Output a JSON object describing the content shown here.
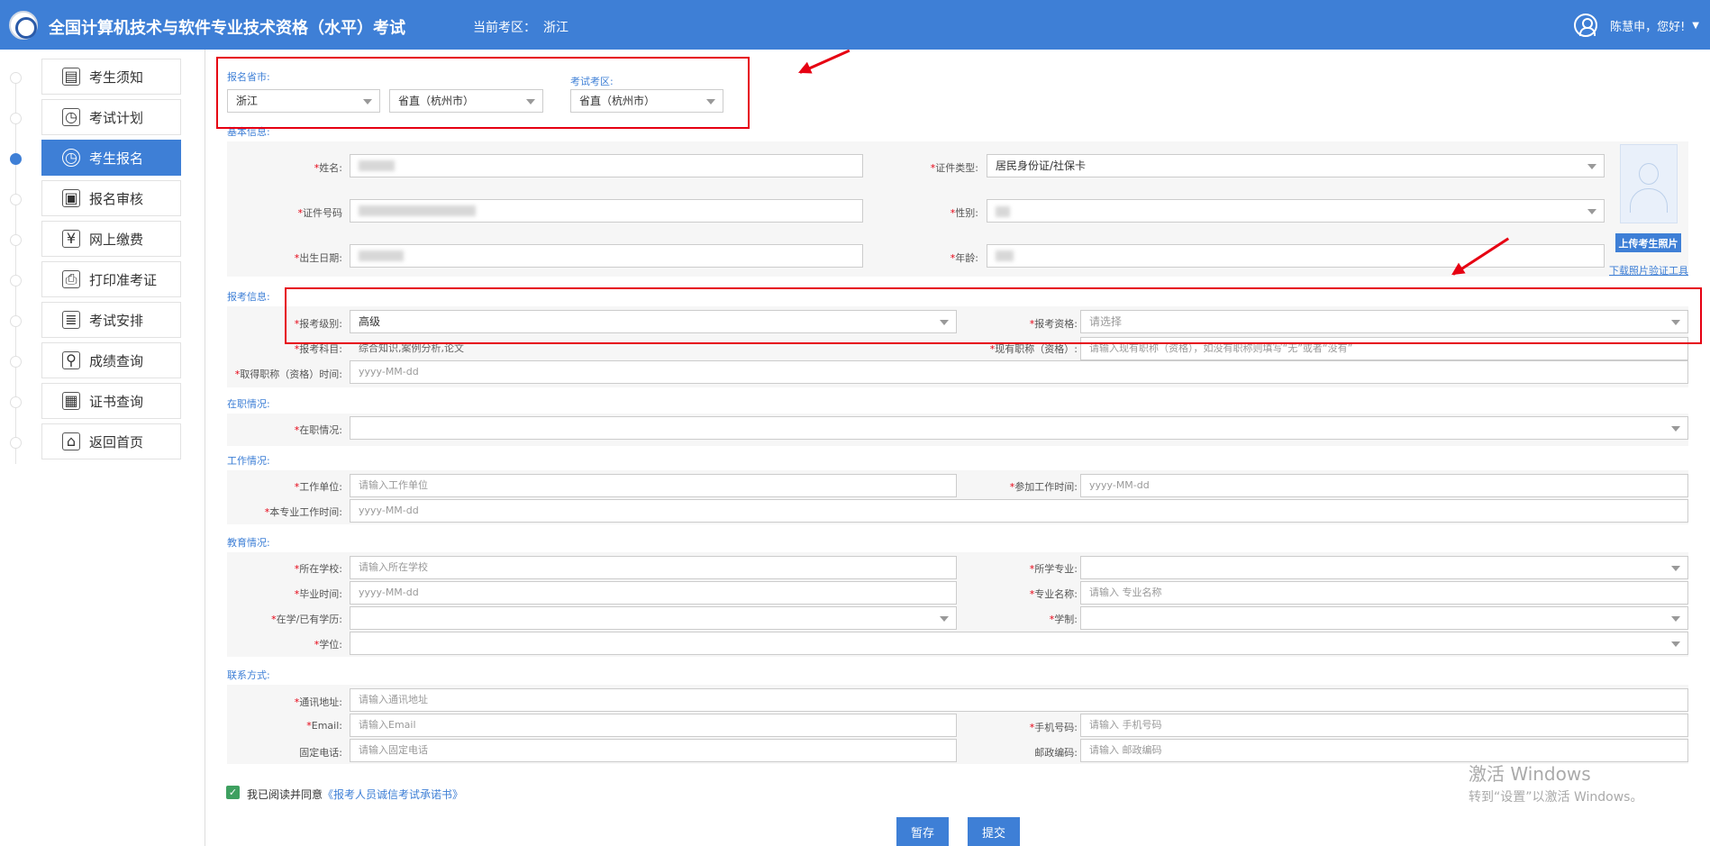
{
  "header": {
    "title": "全国计算机技术与软件专业技术资格（水平）考试",
    "area_label": "当前考区：",
    "area_value": "浙江",
    "greeting": "陈慧申，您好!"
  },
  "sidebar": {
    "items": [
      {
        "label": "考生须知",
        "icon": "▤"
      },
      {
        "label": "考试计划",
        "icon": "◷"
      },
      {
        "label": "考生报名",
        "icon": "◷"
      },
      {
        "label": "报名审核",
        "icon": "▣"
      },
      {
        "label": "网上缴费",
        "icon": "¥"
      },
      {
        "label": "打印准考证",
        "icon": "⎙"
      },
      {
        "label": "考试安排",
        "icon": "≣"
      },
      {
        "label": "成绩查询",
        "icon": "⚲"
      },
      {
        "label": "证书查询",
        "icon": "▦"
      },
      {
        "label": "返回首页",
        "icon": "⌂"
      }
    ]
  },
  "region": {
    "province_label": "报名省市:",
    "exam_area_label": "考试考区:",
    "province_value": "浙江",
    "city_value": "省直（杭州市）",
    "exam_area_value": "省直（杭州市）"
  },
  "basic": {
    "section_label": "基本信息:",
    "name_label": "姓名:",
    "id_type_label": "证件类型:",
    "id_type_value": "居民身份证/社保卡",
    "id_no_label": "证件号码",
    "gender_label": "性别:",
    "birth_label": "出生日期:",
    "age_label": "年龄:",
    "upload_photo": "上传考生照片",
    "download_tool": "下载照片验证工具"
  },
  "apply": {
    "section_label": "报考信息:",
    "level_label": "报考级别:",
    "level_value": "高级",
    "qualification_label": "报考资格:",
    "qualification_placeholder": "请选择",
    "subject_label": "报考科目:",
    "subject_value": "综合知识,案例分析,论文",
    "title_label": "现有职称（资格）:",
    "title_placeholder": "请输入现有职称（资格），如没有职称则填写“无”或者“没有”",
    "title_time_label": "取得职称（资格）时间:",
    "date_placeholder": "yyyy-MM-dd"
  },
  "job": {
    "section_label": "在职情况:",
    "status_label": "在职情况:"
  },
  "work": {
    "section_label": "工作情况:",
    "unit_label": "工作单位:",
    "unit_placeholder": "请输入工作单位",
    "start_label": "参加工作时间:",
    "major_time_label": "本专业工作时间:"
  },
  "edu": {
    "section_label": "教育情况:",
    "school_label": "所在学校:",
    "school_placeholder": "请输入所在学校",
    "major_label": "所学专业:",
    "grad_label": "毕业时间:",
    "major_name_label": "专业名称:",
    "major_name_placeholder": "请输入 专业名称",
    "degree_label": "在学/已有学历:",
    "system_label": "学制:",
    "xuewei_label": "学位:"
  },
  "contact": {
    "section_label": "联系方式:",
    "address_label": "通讯地址:",
    "address_placeholder": "请输入通讯地址",
    "email_label": "Email:",
    "email_placeholder": "请输入Email",
    "phone_label": "手机号码:",
    "phone_placeholder": "请输入 手机号码",
    "tel_label": "固定电话:",
    "tel_placeholder": "请输入固定电话",
    "zip_label": "邮政编码:",
    "zip_placeholder": "请输入 邮政编码"
  },
  "footer": {
    "agree_text": "我已阅读并同意",
    "agree_link": "《报考人员诚信考试承诺书》",
    "save_label": "暂存",
    "submit_label": "提交"
  },
  "watermark": {
    "line1": "激活 Windows",
    "line2": "转到“设置”以激活 Windows。"
  },
  "colors": {
    "primary": "#3e7fd6",
    "annotation_red": "#e60012",
    "required": "#e60012"
  }
}
